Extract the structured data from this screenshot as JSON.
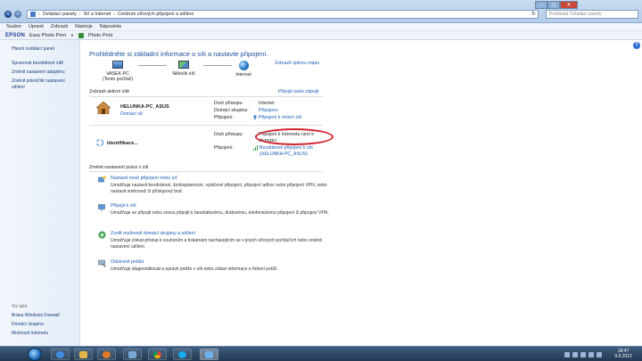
{
  "address_bar": {
    "breadcrumbs": [
      "Ovládací panely",
      "Síť a Internet",
      "Centrum síťových připojení a sdílení"
    ],
    "search_placeholder": "Prohledat Ovládací panely"
  },
  "menu": [
    "Soubor",
    "Upravit",
    "Zobrazit",
    "Nástroje",
    "Nápověda"
  ],
  "toolbar": {
    "brand": "EPSON",
    "easy_photo_print": "Easy Photo Print",
    "photo_print": "Photo Print"
  },
  "sidebar": {
    "home": "Hlavní ovládací panel",
    "links": [
      "Spravovat bezdrátové sítě",
      "Změnit nastavení adaptéru",
      "Změnit pokročilé nastavení sdílení"
    ],
    "see_also_caption": "Viz také",
    "see_also": [
      "Brána Windows Firewall",
      "Domácí skupina",
      "Možnosti Internetu"
    ]
  },
  "main": {
    "title": "Prohlédněte si základní informace o síti a nastavte připojení.",
    "full_map_link": "Zobrazit úplnou mapu",
    "map": {
      "node1": "VASEK-PC",
      "node1_sub": "(Tento počítač)",
      "node2": "Několik sítí",
      "node3": "Internet"
    },
    "active_networks_label": "Zobrazit aktivní sítě",
    "connect_disconnect_link": "Připojit nebo odpojit",
    "network1": {
      "name": "HELUNKA-PC_ASUS",
      "type": "Domácí síť",
      "access_type_label": "Druh přístupu:",
      "access_type_value": "Internet",
      "homegroup_label": "Domácí skupina:",
      "homegroup_value": "Připojeno",
      "connections_label": "Připojení:",
      "connections_value": "Připojení k místní síti"
    },
    "network2": {
      "name": "Identifikace...",
      "access_type_label": "Druh přístupu:",
      "access_type_value": "Připojení k Internetu není k dispozici",
      "connections_label": "Připojení:",
      "connections_value": "Bezdrátové připojení k síti (HELUNKA-PC_ASUS)"
    },
    "change_settings_label": "Změnit nastavení práce v síti",
    "tasks": [
      {
        "title": "Nastavit nové připojení nebo síť",
        "desc": "Umožňuje nastavit bezdrátové, širokopásmové, vytáčené připojení, připojení adhoc nebo připojení VPN, nebo nastavit směrovač či přístupový bod."
      },
      {
        "title": "Připojit k síti",
        "desc": "Umožňuje se připojit nebo znovu připojit k bezdrátovému, drátovému, telefonickému připojení či připojení VPN."
      },
      {
        "title": "Zvolit možnosti domácí skupiny a sdílení",
        "desc": "Umožňuje získat přístup k souborům a tiskárnám nacházejícím se v jiných síťových počítačích nebo změnit nastavení sdílení."
      },
      {
        "title": "Odstranit potíže",
        "desc": "Umožňuje diagnostikovat a opravit potíže v síti nebo získat informace o řešení potíží."
      }
    ]
  },
  "taskbar": {
    "time": "18:47",
    "date": "9.9.2012"
  },
  "colors": {
    "link": "#1c5fb8",
    "title": "#1c4f9c",
    "annotation": "#d3202a",
    "taskbar": "#22384f"
  }
}
